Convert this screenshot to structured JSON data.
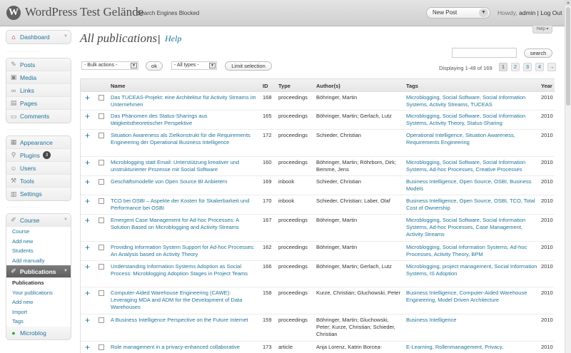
{
  "header": {
    "site_title": "WordPress Test Gelände",
    "site_status": "Search Engines Blocked",
    "new_post_label": "New Post",
    "howdy_prefix": "Howdy,",
    "username": "admin",
    "logout_label": "| Log Out",
    "help_tab": "Help"
  },
  "sidebar": {
    "dashboard": "Dashboard",
    "group1": [
      "Posts",
      "Media",
      "Links",
      "Pages",
      "Comments"
    ],
    "group2": [
      "Appearance",
      "Plugins",
      "Users",
      "Tools",
      "Settings"
    ],
    "plugins_badge": "3",
    "course": {
      "label": "Course",
      "items": [
        "Course",
        "Add new",
        "Students",
        "Add manually"
      ]
    },
    "publications": {
      "label": "Publications",
      "items": [
        "Publications",
        "Your publications",
        "Add new",
        "Import",
        "Tags"
      ]
    },
    "microblog": "Microblog"
  },
  "page": {
    "title": "All publications",
    "separator": "|",
    "help_link": "Help",
    "search_button": "search",
    "search_value": "",
    "bulk_actions": "- Bulk actions -",
    "ok_button": "ok",
    "all_types": "- All types -",
    "limit_selection": "Limit selection",
    "displaying": "Displaying 1-49 of 169",
    "pages": [
      "1",
      "2",
      "3",
      "4",
      "→"
    ]
  },
  "table": {
    "columns": {
      "name": "Name",
      "id": "ID",
      "type": "Type",
      "authors": "Author(s)",
      "tags": "Tags",
      "year": "Year"
    },
    "rows": [
      {
        "name": "Das TUCEAS-Projekt: eine Architektur für Activity Streams im Unternehmen",
        "id": "168",
        "type": "proceedings",
        "authors": "Böhringer, Martin",
        "tags": "Microblogging, Social Software, Social Information Systems, Activity Streams, TUCEAS",
        "year": "2010"
      },
      {
        "name": "Das Phänomen des Status-Sharings aus tätigkeitstheoretischer Perspektive",
        "id": "165",
        "type": "proceedings",
        "authors": "Böhringer, Martin; Gerlach, Lutz",
        "tags": "Microblogging, Social Software, Social Information Systems, Activity Theory, Status-Sharing",
        "year": "2010"
      },
      {
        "name": "Situation Awareness als Zielkonstrukt für die Requirements Engineering der Operational Business Intelligence",
        "id": "172",
        "type": "proceedings",
        "authors": "Schieder, Christian",
        "tags": "Operational Intelligence, Situation Awareness, Requirements Engineering",
        "year": "2010"
      },
      {
        "name": "Microblogging statt Email: Unterstützung kreativer und unstrukturierter Prozesse mit Social Software",
        "id": "160",
        "type": "proceedings",
        "authors": "Böhringer, Martin; Röhrborn, Dirk; Bemme, Jens",
        "tags": "Microblogging, Social Software, Social Information Systems, Ad-hoc Processes, Creative Processes",
        "year": "2010"
      },
      {
        "name": "Geschäftsmodelle von Open Source BI Anbietern",
        "id": "169",
        "type": "inbook",
        "authors": "Schieder, Christian",
        "tags": "Business Intelligence, Open Source, OSBI, Business Models",
        "year": "2010"
      },
      {
        "name": "TCO bei OSBI – Aspekte der Kosten für Skalierbarkeit und Performance bei OSBI",
        "id": "170",
        "type": "inbook",
        "authors": "Schieder, Christian; Laber, Olaf",
        "tags": "Business Intelligence, Open Source, OSBI, TCO, Total Cost of Ownership",
        "year": "2010"
      },
      {
        "name": "Emergent Case Management for Ad-hoc Processes: A Solution Based on Microblogging and Activity Streams",
        "id": "167",
        "type": "proceedings",
        "authors": "Böhringer, Martin",
        "tags": "Microblogging, Social Software, Social Information Systems, Ad-hoc Processes, Case Management, Activity Streams",
        "year": "2010"
      },
      {
        "name": "Providing Information System Support for Ad-hoc Processes: An Analysis based on Activity Theory",
        "id": "162",
        "type": "proceedings",
        "authors": "Böhringer, Martin",
        "tags": "Microblogging, Social Information Systems, Ad-hoc Processes, Activity Theory, BPM",
        "year": "2010"
      },
      {
        "name": "Understanding Information Systems Adoption as Social Process: Microblogging Adoption Stages in Project Teams",
        "id": "166",
        "type": "proceedings",
        "authors": "Böhringer, Martin; Gerlach, Lutz",
        "tags": "Microblogging, project management, Social Information Systems, IS Adoption",
        "year": "2010"
      },
      {
        "name": "Computer-Aided Warehouse Engineering (CAWE): Leveraging MDA and ADM for the Development of Data Warehouses",
        "id": "158",
        "type": "proceedings",
        "authors": "Kurze, Christian; Gluchowski, Peter",
        "tags": "Business Intelligence, Computer-Aided Warehouse Engineering, Model Driven Architecture",
        "year": "2010"
      },
      {
        "name": "A Business Intelligence Perspective on the Future Internet",
        "id": "159",
        "type": "proceedings",
        "authors": "Böhringer, Martin; Gluchowski, Peter; Kurze, Christian; Schieder, Christian",
        "tags": "Business Intelligence",
        "year": "2010"
      },
      {
        "name": "Role management in a privacy-enhanced collaborative",
        "id": "173",
        "type": "article",
        "authors": "Anja Lorenz, Katrin Borcea-",
        "tags": "E-Learning, Rollenmanagement, Privacy,",
        "year": "2010"
      }
    ]
  },
  "colors": {
    "link": "#21759b",
    "header_bg": "#d9d9d9",
    "current_menu": "#6d6d6d"
  }
}
